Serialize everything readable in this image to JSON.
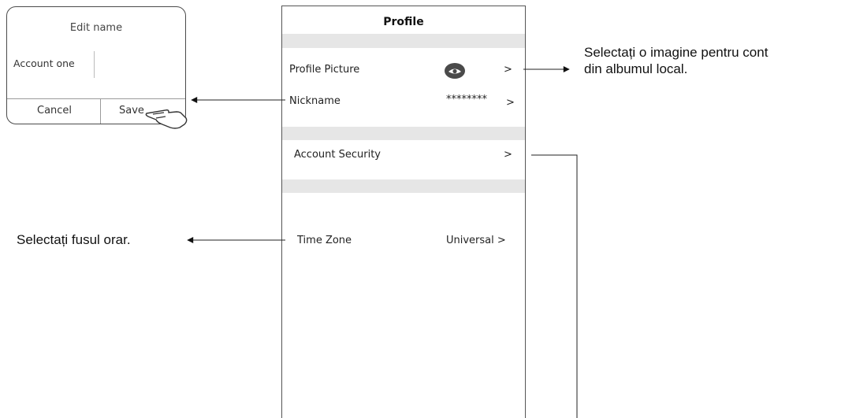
{
  "dialog": {
    "title": "Edit name",
    "input_value": "Account one",
    "cancel_label": "Cancel",
    "save_label": "Save"
  },
  "profile": {
    "title": "Profile",
    "rows": {
      "picture": {
        "label": "Profile Picture",
        "chevron": ">"
      },
      "nickname": {
        "label": "Nickname",
        "value": "********",
        "chevron": ">"
      },
      "security": {
        "label": "Account Security",
        "chevron": ">"
      },
      "timezone": {
        "label": "Time Zone",
        "value": "Universal >"
      }
    }
  },
  "annotations": {
    "picture_note_line1": "Selectați o imagine pentru cont",
    "picture_note_line2": "din albumul local.",
    "timezone_note": "Selectați fusul orar."
  }
}
